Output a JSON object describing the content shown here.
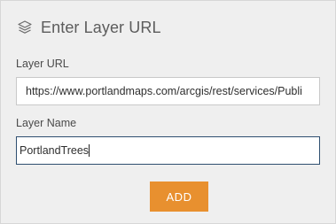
{
  "header": {
    "icon": "layers-icon",
    "title": "Enter Layer URL"
  },
  "form": {
    "url_label": "Layer URL",
    "url_value": "https://www.portlandmaps.com/arcgis/rest/services/Publi",
    "name_label": "Layer Name",
    "name_value": "PortlandTrees",
    "submit_label": "ADD"
  },
  "colors": {
    "accent": "#e8902f",
    "panel_bg": "#efefef",
    "focus_border": "#2f4f70"
  }
}
